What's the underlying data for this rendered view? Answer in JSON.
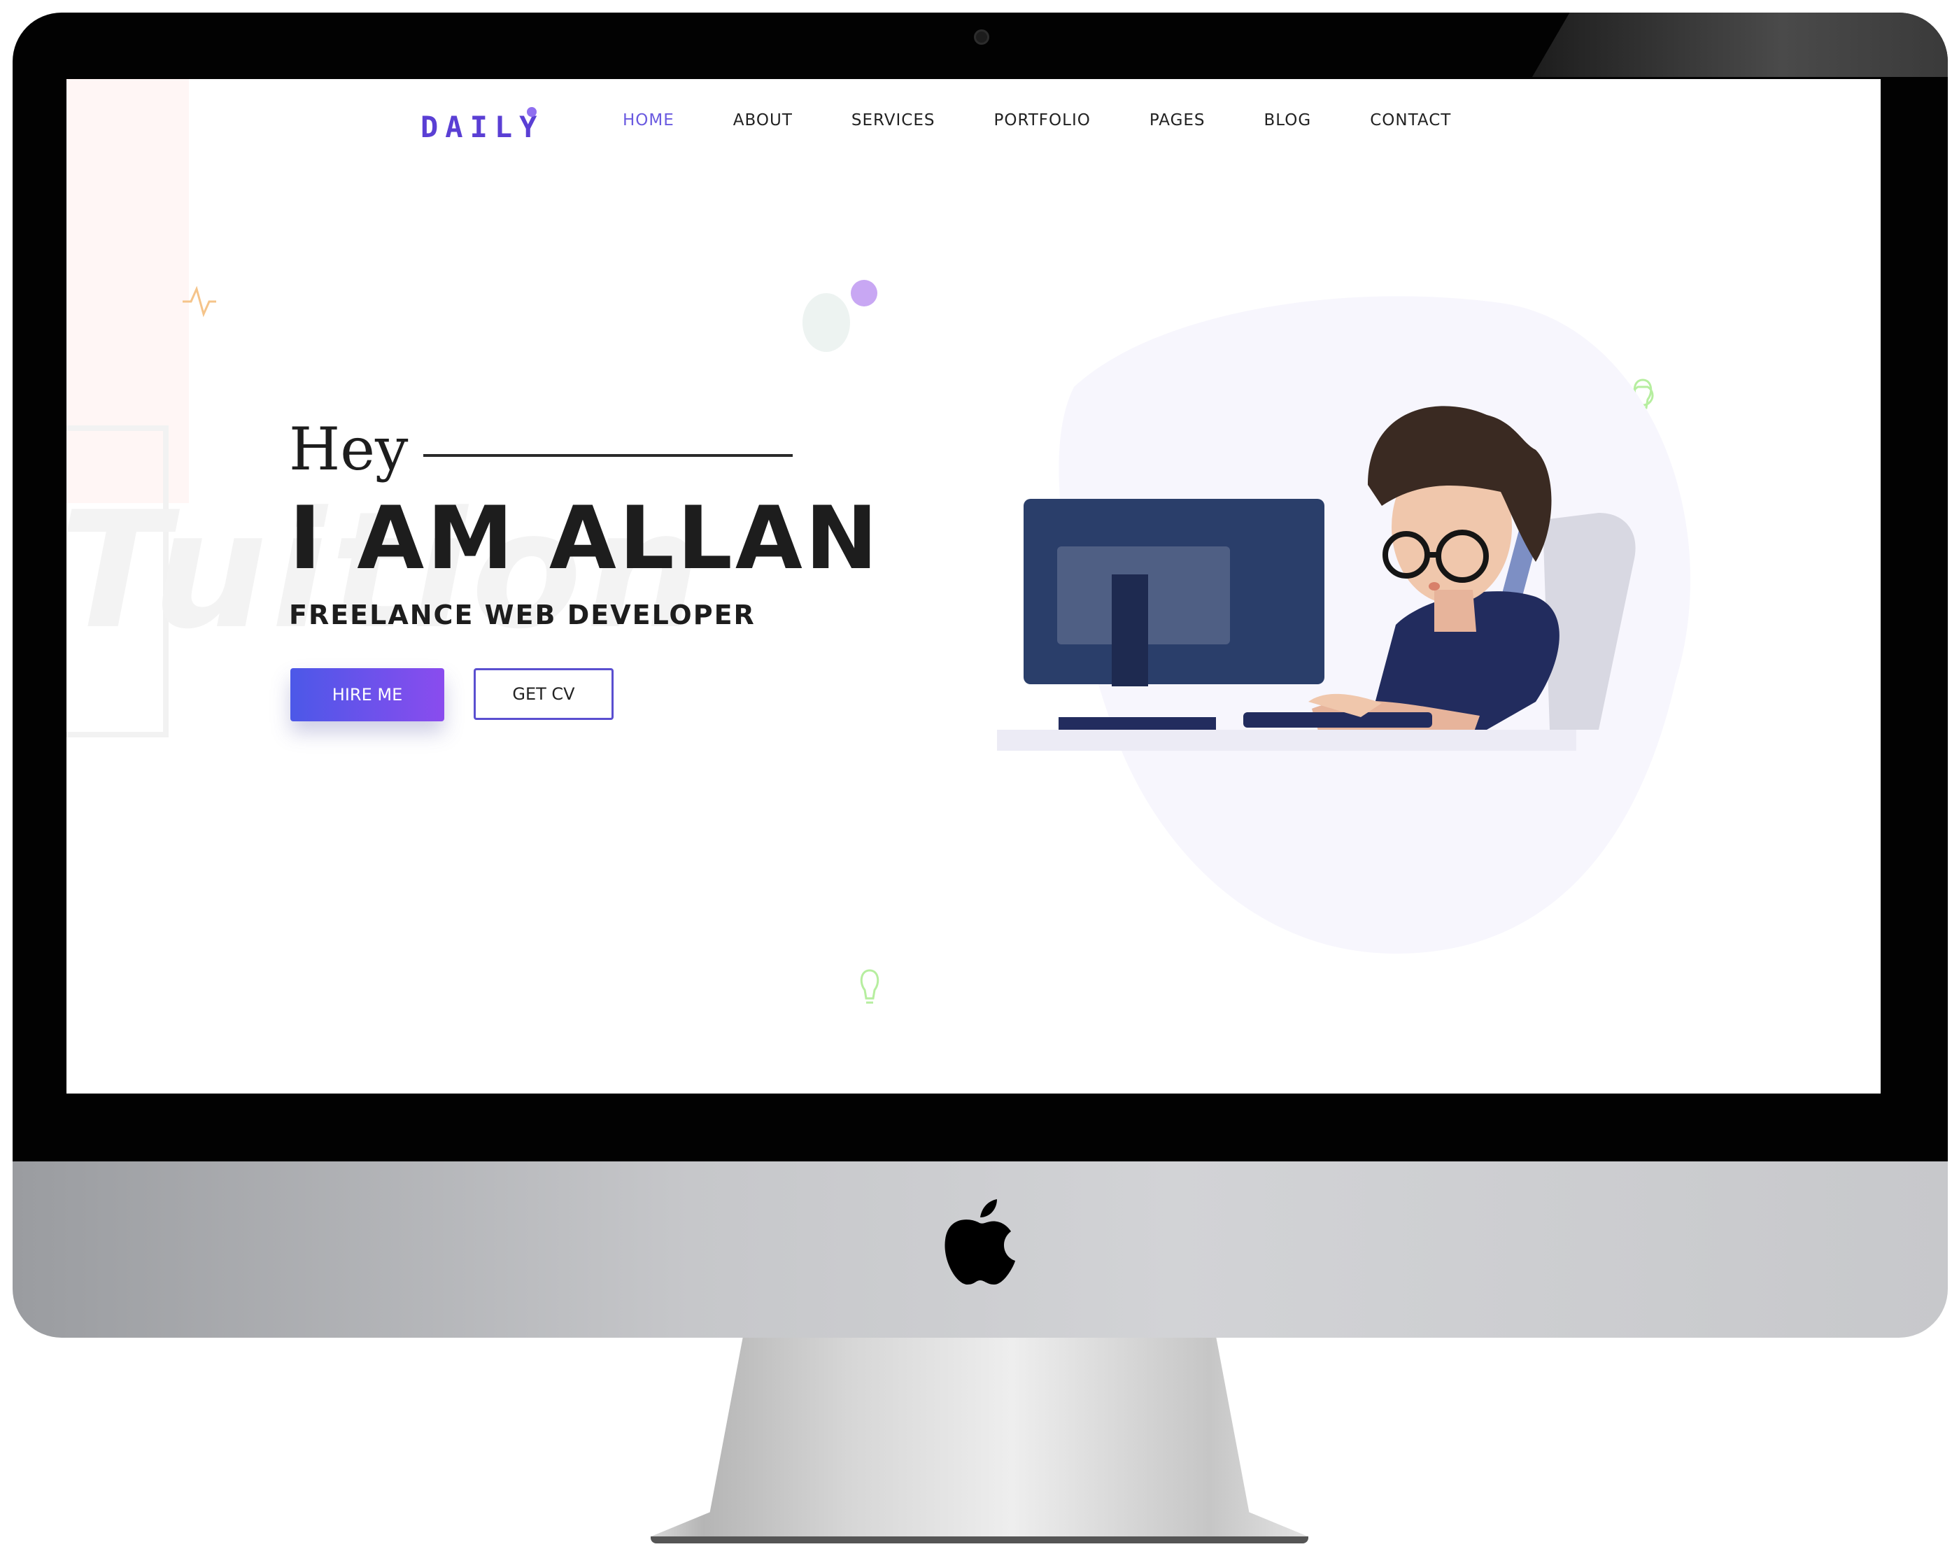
{
  "brand": {
    "logo_text": "DAILY",
    "accent": "#6a5ae0"
  },
  "nav": {
    "items": [
      {
        "label": "HOME",
        "active": true
      },
      {
        "label": "ABOUT"
      },
      {
        "label": "SERVICES"
      },
      {
        "label": "PORTFOLIO"
      },
      {
        "label": "PAGES"
      },
      {
        "label": "BLOG"
      },
      {
        "label": "CONTACT"
      }
    ]
  },
  "hero": {
    "greeting": "Hey",
    "name": "I AM ALLAN",
    "role": "FREELANCE WEB DEVELOPER",
    "background_watermark": "Tuition",
    "buttons": {
      "hire": "HIRE ME",
      "cv": "GET CV"
    }
  },
  "colors": {
    "button_gradient_start": "#4c58e8",
    "button_gradient_end": "#8a4cee",
    "blob": "#f7f6fd",
    "monitor_dark": "#2a3e6a"
  },
  "icons": [
    "pulse-icon",
    "lightbulb-icon",
    "apple-logo-icon"
  ]
}
